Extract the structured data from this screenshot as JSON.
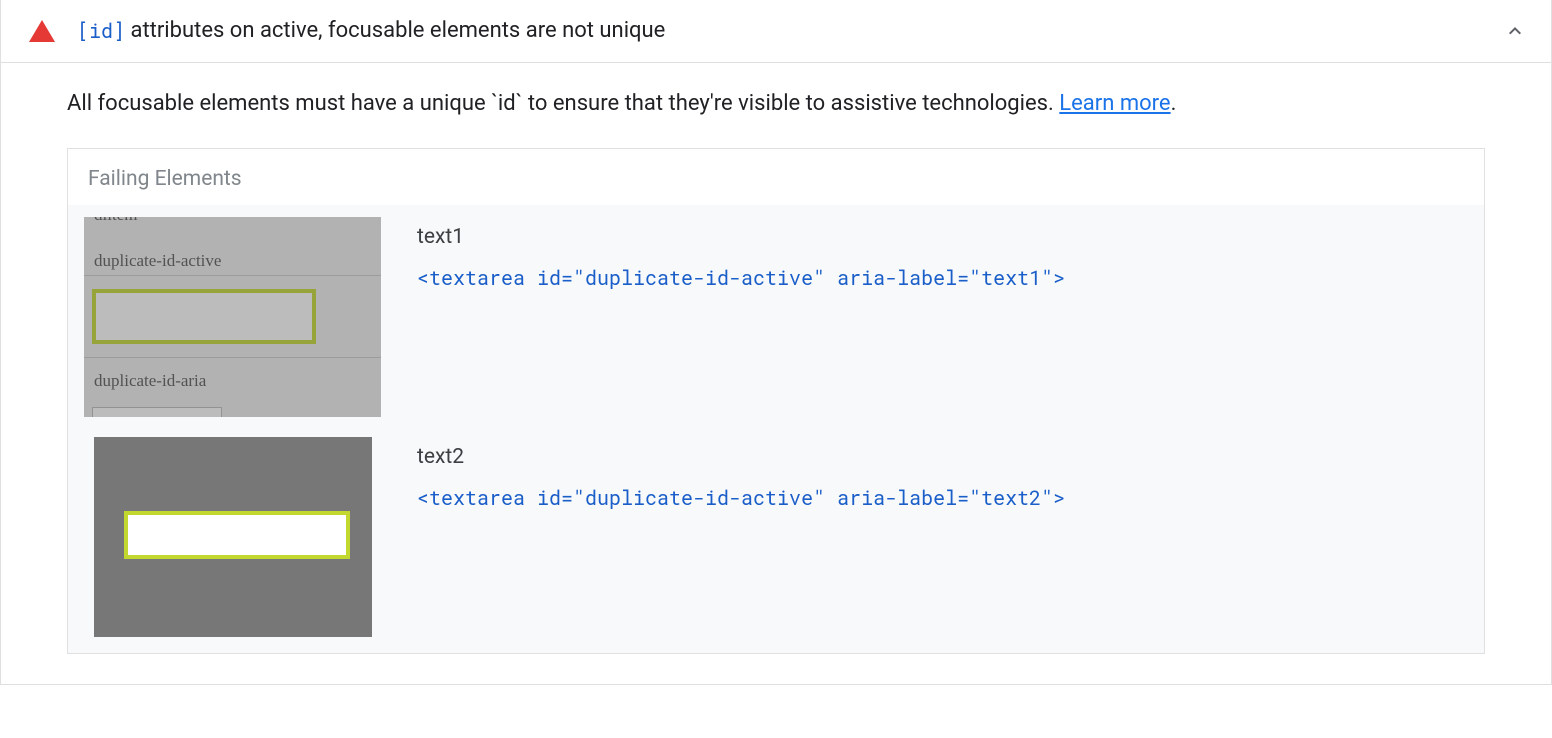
{
  "audit": {
    "title_code": "[id]",
    "title_text": " attributes on active, focusable elements are not unique",
    "description": "All focusable elements must have a unique `id` to ensure that they're visible to assistive technologies. ",
    "learn_more": "Learn more",
    "failing": {
      "header": "Failing Elements",
      "items": [
        {
          "label": "text1",
          "code": "<textarea id=\"duplicate-id-active\" aria-label=\"text1\">",
          "thumb_labels": {
            "top": "dlitem",
            "label1": "duplicate-id-active",
            "label2": "duplicate-id-aria"
          }
        },
        {
          "label": "text2",
          "code": "<textarea id=\"duplicate-id-active\" aria-label=\"text2\">"
        }
      ]
    }
  }
}
